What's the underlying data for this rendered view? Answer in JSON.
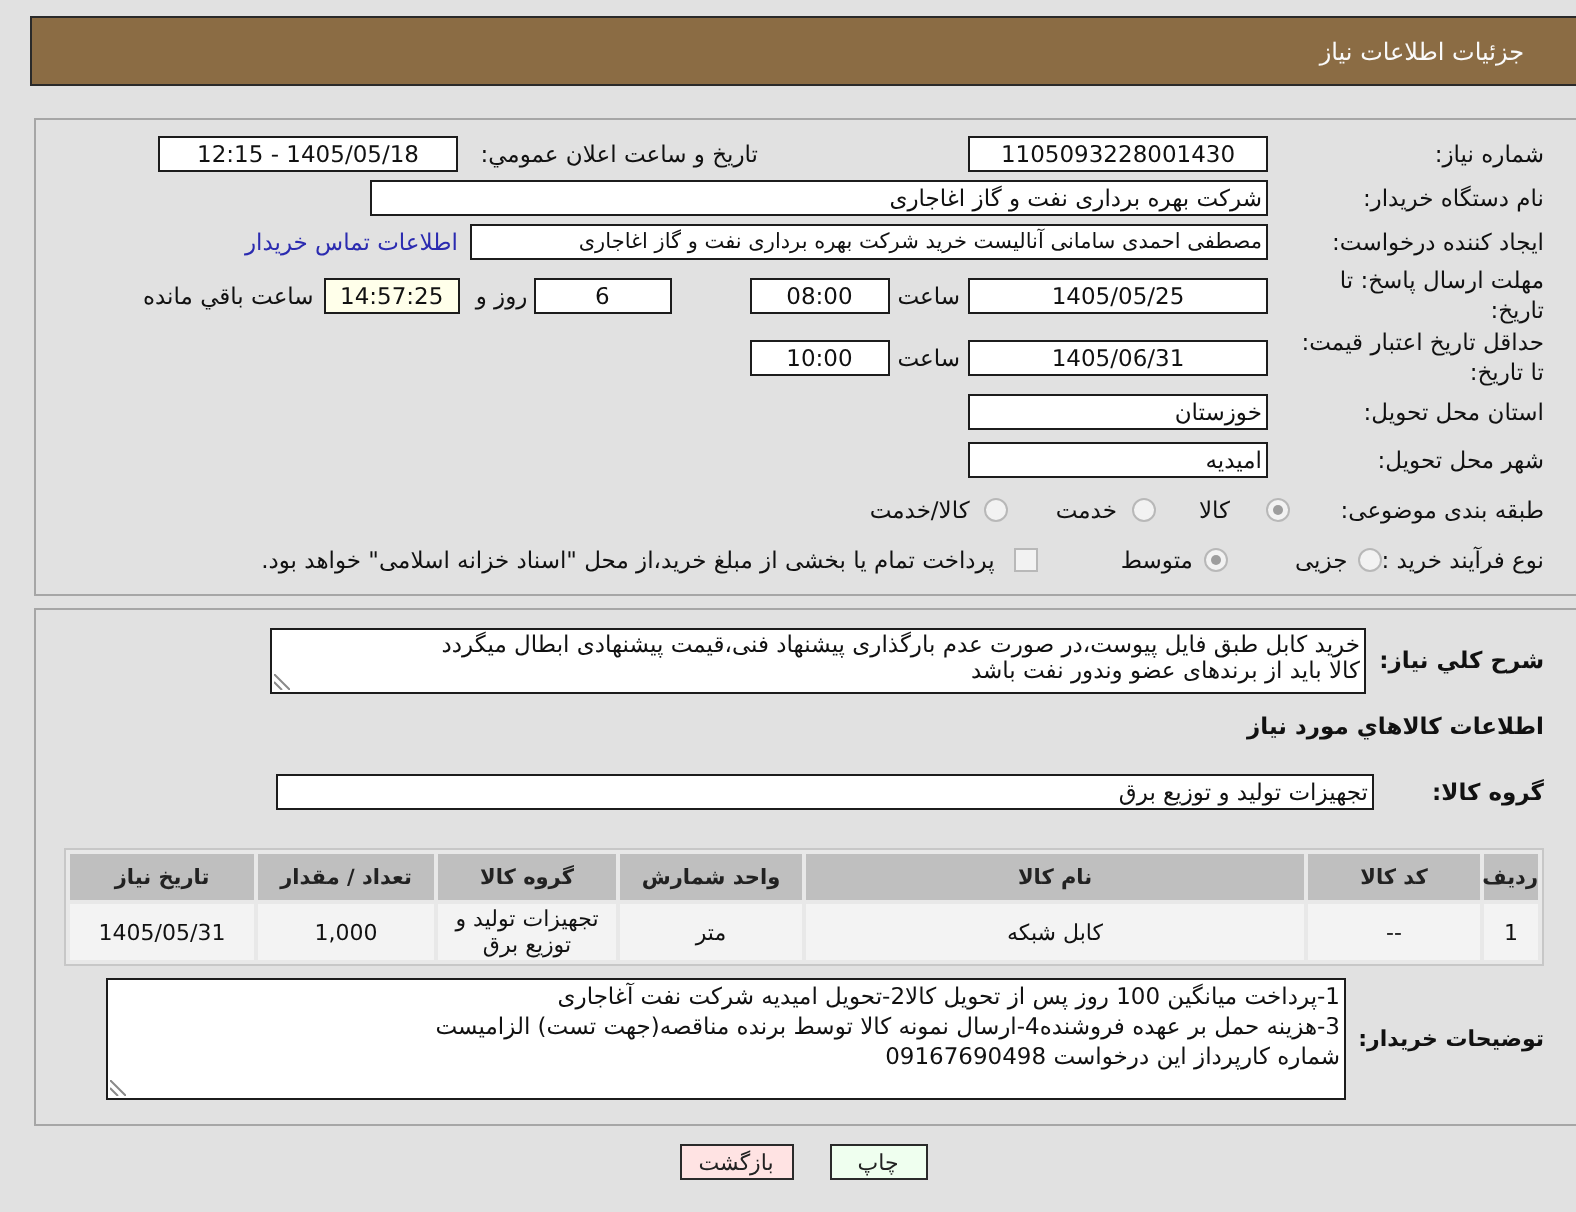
{
  "header": {
    "title": "جزئیات اطلاعات نیاز"
  },
  "details": {
    "need_number": {
      "label": "شماره نیاز:",
      "value": "1105093228001430"
    },
    "announcement": {
      "label": "تاریخ و ساعت اعلان عمومي:",
      "value": "1405/05/18 - 12:15"
    },
    "buyer_org": {
      "label": "نام دستگاه خریدار:",
      "value": "شرکت بهره برداری نفت و گاز اغاجاری"
    },
    "requester": {
      "label": "ایجاد کننده درخواست:",
      "value": "مصطفی احمدی سامانی آنالیست خرید شرکت بهره برداری نفت و گاز اغاجاری",
      "link": "اطلاعات تماس خریدار"
    },
    "response_deadline": {
      "label": "مهلت ارسال پاسخ: تا تاریخ:",
      "date": "1405/05/25",
      "time_label": "ساعت",
      "time": "08:00",
      "days": "6",
      "days_label": "روز و",
      "remaining": "14:57:25",
      "remaining_label": "ساعت باقي مانده"
    },
    "price_validity": {
      "label": "حداقل تاریخ اعتبار قیمت: تا تاریخ:",
      "date": "1405/06/31",
      "time_label": "ساعت",
      "time": "10:00"
    },
    "province": {
      "label": "استان محل تحویل:",
      "value": "خوزستان"
    },
    "city": {
      "label": "شهر محل تحویل:",
      "value": "امیدیه"
    },
    "category": {
      "label": "طبقه بندی موضوعی:",
      "disabled": true,
      "options": [
        {
          "label": "کالا",
          "selected": true
        },
        {
          "label": "خدمت",
          "selected": false
        },
        {
          "label": "کالا/خدمت",
          "selected": false
        }
      ]
    },
    "purchase_process": {
      "label": "نوع فرآیند خرید :",
      "disabled": true,
      "options": [
        {
          "label": "جزیی",
          "selected": false
        },
        {
          "label": "متوسط",
          "selected": true
        }
      ],
      "treasury": {
        "label": "پرداخت تمام یا بخشی از مبلغ خرید،از محل \"اسناد خزانه اسلامی\" خواهد بود.",
        "checked": false
      }
    }
  },
  "needs": {
    "description": {
      "label": "شرح کلي نیاز:",
      "value": "خرید کابل طبق فایل پیوست،در صورت عدم بارگذاری پیشنهاد فنی،قیمت پیشنهادی ابطال میگردد\nکالا باید از برندهای عضو وندور نفت باشد"
    },
    "goods_title": "اطلاعات کالاهاي مورد نیاز",
    "goods_group": {
      "label": "گروه کالا:",
      "value": "تجهیزات تولید و توزیع برق"
    },
    "table": {
      "columns": [
        "ردیف",
        "کد کالا",
        "نام کالا",
        "واحد شمارش",
        "گروه کالا",
        "تعداد / مقدار",
        "تاریخ نیاز"
      ],
      "rows": [
        [
          "1",
          "--",
          "کابل شبکه",
          "متر",
          "تجهیزات تولید و توزیع برق",
          "1,000",
          "1405/05/31"
        ]
      ]
    },
    "buyer_notes": {
      "label": "توضیحات خریدار:",
      "value": "1-پرداخت میانگین 100 روز پس از تحویل کالا2-تحویل امیدیه شرکت نفت آغاجاری\n3-هزینه حمل بر عهده فروشنده4-ارسال نمونه کالا توسط برنده مناقصه(جهت تست) الزامیست\nشماره کارپرداز این درخواست 09167690498"
    }
  },
  "buttons": [
    {
      "label": "چاپ",
      "kind": "print"
    },
    {
      "label": "بازگشت",
      "kind": "back"
    }
  ]
}
